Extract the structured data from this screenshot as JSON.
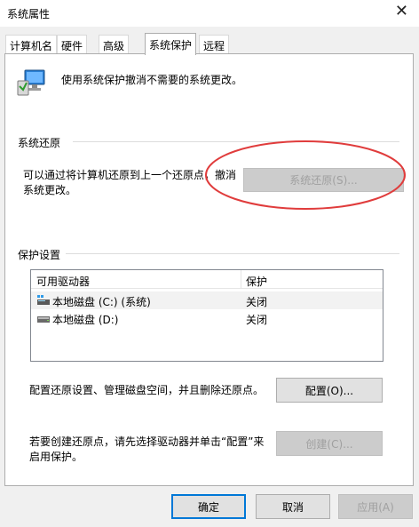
{
  "window": {
    "title": "系统属性",
    "close_glyph": "✕"
  },
  "tabs": [
    {
      "label": "计算机名",
      "active": false
    },
    {
      "label": "硬件",
      "active": false
    },
    {
      "label": "高级",
      "active": false
    },
    {
      "label": "系统保护",
      "active": true
    },
    {
      "label": "远程",
      "active": false
    }
  ],
  "intro": {
    "text": "使用系统保护撤消不需要的系统更改。",
    "icon": "system-protection-icon"
  },
  "restore": {
    "group_label": "系统还原",
    "desc_line1": "可以通过将计算机还原到上一个还原点，撤消",
    "desc_line2": "系统更改。",
    "button_label": "系统还原(S)...",
    "button_enabled": false
  },
  "protection": {
    "group_label": "保护设置",
    "columns": [
      "可用驱动器",
      "保护"
    ],
    "drives": [
      {
        "name": "本地磁盘 (C:) (系统)",
        "status": "关闭",
        "icon": "system-drive-icon",
        "selected": true
      },
      {
        "name": "本地磁盘 (D:)",
        "status": "关闭",
        "icon": "drive-icon",
        "selected": false
      }
    ],
    "configure_desc": "配置还原设置、管理磁盘空间，并且删除还原点。",
    "configure_button": "配置(O)...",
    "create_desc_line1": "若要创建还原点，请先选择驱动器并单击“配置”来",
    "create_desc_line2": "启用保护。",
    "create_button": "创建(C)...",
    "create_enabled": false
  },
  "footer": {
    "ok": "确定",
    "cancel": "取消",
    "apply": "应用(A)",
    "apply_enabled": false
  },
  "colors": {
    "annotation": "#e03c3c",
    "focus": "#0078d7"
  }
}
